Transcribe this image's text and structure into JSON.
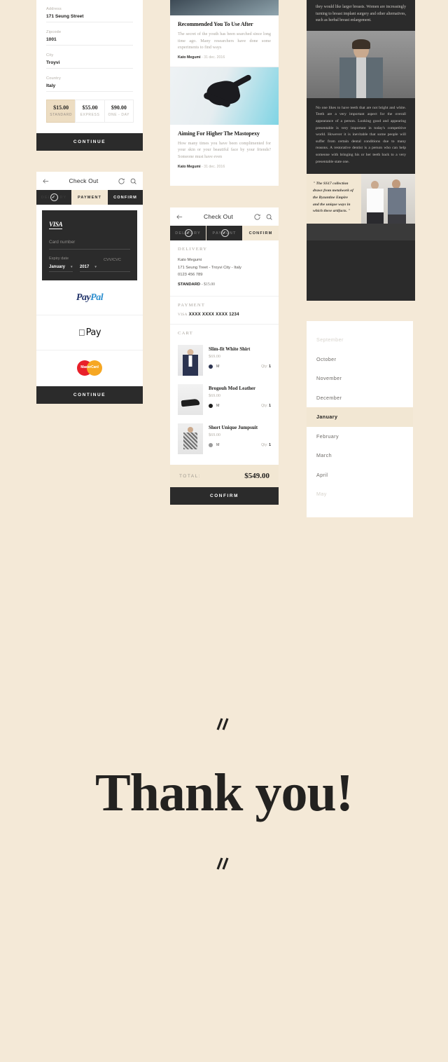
{
  "shipping_form": {
    "fields": [
      {
        "label": "Address",
        "value": "171 Seung Street"
      },
      {
        "label": "Zipcode",
        "value": "1001"
      },
      {
        "label": "City",
        "value": "Troyvi"
      },
      {
        "label": "Country",
        "value": "Italy"
      }
    ],
    "shipping_options": [
      {
        "price": "$15.00",
        "name": "STANDARD",
        "selected": true
      },
      {
        "price": "$55.00",
        "name": "EXPRESS",
        "selected": false
      },
      {
        "price": "$90.00",
        "name": "ONE - DAY",
        "selected": false
      }
    ],
    "continue_label": "CONTINUE"
  },
  "payment_screen": {
    "header": {
      "title": "Check Out",
      "back_icon": "back-arrow-icon",
      "refresh_icon": "refresh-icon",
      "search_icon": "search-icon"
    },
    "tabs": [
      {
        "label": "DELIVERY",
        "state": "done"
      },
      {
        "label": "PAYMENT",
        "state": "active"
      },
      {
        "label": "CONFIRM",
        "state": "inactive"
      }
    ],
    "card": {
      "brand": "VISA",
      "card_number_placeholder": "Card number",
      "expiry_label": "Expiry date",
      "month": "January",
      "year": "2017",
      "cvv_label": "CVV/CVC"
    },
    "methods": [
      {
        "name": "paypal-logo",
        "text_a": "Pay",
        "text_b": "Pal"
      },
      {
        "name": "apple-pay-logo",
        "text": "Pay"
      },
      {
        "name": "mastercard-logo",
        "text": "MasterCard"
      }
    ],
    "continue_label": "CONTINUE"
  },
  "blog": {
    "articles": [
      {
        "title": "Recommended You To Use After",
        "excerpt": "The secret of the youth has been searched since long time ago. Many researchers have done some experiments to find ways",
        "author": "Kato Megumi",
        "date": "- 31 dec. 2016"
      },
      {
        "title": "Aiming For Higher The Mastopexy",
        "excerpt": "How many times you have been complimented for your skin or your beautiful face by your friends? Someone must have even",
        "author": "Kato Megumi",
        "date": "- 31 dec. 2016"
      }
    ]
  },
  "confirm_screen": {
    "header": {
      "title": "Check Out",
      "back_icon": "back-arrow-icon",
      "refresh_icon": "refresh-icon",
      "search_icon": "search-icon"
    },
    "tabs": [
      {
        "label": "DELIVERY",
        "state": "done"
      },
      {
        "label": "PAYMENT",
        "state": "done"
      },
      {
        "label": "CONFIRM",
        "state": "active"
      }
    ],
    "delivery": {
      "heading": "DELIVERY",
      "name": "Kato Megumi",
      "address": "171 Seung Treet - Troyvi City - Italy",
      "phone": "0123 456 789",
      "method": "STANDARD",
      "method_price": "- $15.00"
    },
    "payment": {
      "heading": "PAYMENT",
      "brand": "VISA",
      "number": "XXXX XXXX XXXX 1234"
    },
    "cart": {
      "heading": "CART",
      "items": [
        {
          "name": "Slim-fit White Shirt",
          "price": "$69.00",
          "size": "M",
          "color": "#2b3350",
          "qty_label": "Qty:",
          "qty": "1"
        },
        {
          "name": "Brogouh Mod Leather",
          "price": "$69.00",
          "size": "M",
          "color": "#1d1d1d",
          "qty_label": "Qty:",
          "qty": "1"
        },
        {
          "name": "Short Unique Jumpsuit",
          "price": "$69.00",
          "size": "M",
          "color": "#9a9a9a",
          "qty_label": "Qty:",
          "qty": "1"
        }
      ]
    },
    "total_label": "TOTAL:",
    "total_value": "$549.00",
    "confirm_label": "CONFIRM"
  },
  "dark_article": {
    "intro": "they would like larger breasts. Women are increasingly turning to breast implant surgery and other alternatives, such as herbal breast enlargement.",
    "body": "No one likes to have teeth that are not bright and white. Teeth are a very important aspect for the overall appearance of a person. Looking good and appearing presentable is very important in today's competitive world. However it is inevitable that some people will suffer from certain dental conditions due to many reasons. A restorative dentist is a person who can help someone with bringing his or her teeth back to a very presentable state one.",
    "quote": "\" The SS17 collection draws from metalwork of the Byzantine Empire and the unique ways in which these artifacts. \""
  },
  "month_picker": {
    "months": [
      {
        "label": "September",
        "state": "dim"
      },
      {
        "label": "October",
        "state": "normal"
      },
      {
        "label": "November",
        "state": "normal"
      },
      {
        "label": "December",
        "state": "normal"
      },
      {
        "label": "January",
        "state": "selected"
      },
      {
        "label": "February",
        "state": "normal"
      },
      {
        "label": "March",
        "state": "normal"
      },
      {
        "label": "April",
        "state": "normal"
      },
      {
        "label": "May",
        "state": "dim"
      }
    ]
  },
  "thanks": {
    "text": "Thank you!",
    "ornament": "double-slash-ornament"
  },
  "colors": {
    "background": "#f4e9d7",
    "dark": "#2b2b2b",
    "accent": "#f2e7d3",
    "accent_strong": "#edddc2",
    "muted_text": "#a9a49c"
  }
}
